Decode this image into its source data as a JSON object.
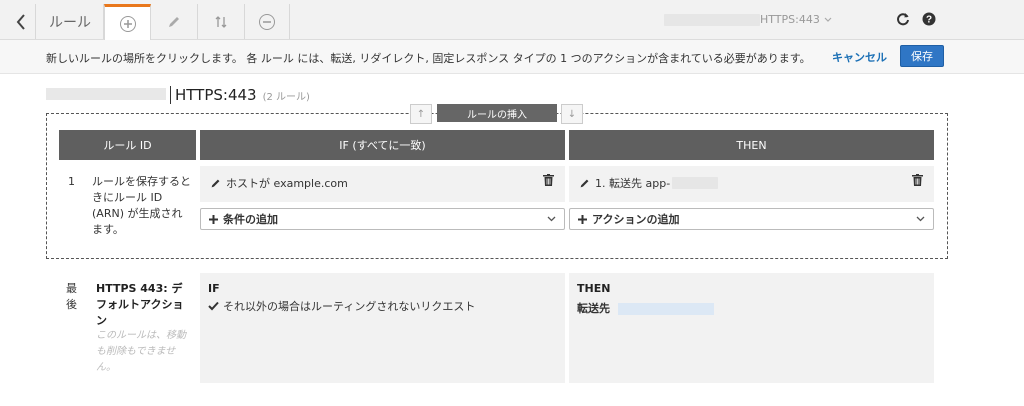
{
  "toolbar": {
    "back_icon": "chevron-left-icon",
    "rules_tab": "ルール",
    "listener": "HTTPS:443",
    "icons": [
      "plus-circle-icon",
      "pencil-icon",
      "reorder-icon",
      "minus-circle-icon",
      "refresh-icon",
      "help-icon"
    ]
  },
  "infobar": {
    "text": "新しいルールの場所をクリックします。 各 ルール には、転送, リダイレクト, 固定レスポンス タイプの 1 つのアクションが含まれている必要があります。",
    "cancel": "キャンセル",
    "save": "保存"
  },
  "title": {
    "listener": "HTTPS:443",
    "count": "(2 ルール)"
  },
  "insert": {
    "label": "ルールの挿入",
    "up": "↑",
    "down": "↓"
  },
  "table": {
    "headers": [
      "ルール ID",
      "IF (すべてに一致)",
      "THEN"
    ]
  },
  "rule1": {
    "id": "1",
    "description": "ルールを保存するときにルール ID (ARN) が生成されます。",
    "condition": "ホストが example.com",
    "add_condition": "条件の追加",
    "action": "1. 転送先 app-",
    "add_action": "アクションの追加"
  },
  "last_rule": {
    "label": "最後",
    "name": "HTTPS 443: デフォルトアクション",
    "note": "このルールは、移動も削除もできません。",
    "if_head": "IF",
    "if_text": "それ以外の場合はルーティングされないリクエスト",
    "then_head": "THEN",
    "then_text": "転送先"
  },
  "colors": {
    "accent_tab": "#e9781c",
    "save_button": "#2f76c5",
    "header_bg": "#5f5f5f",
    "link": "#1a6fb5"
  }
}
